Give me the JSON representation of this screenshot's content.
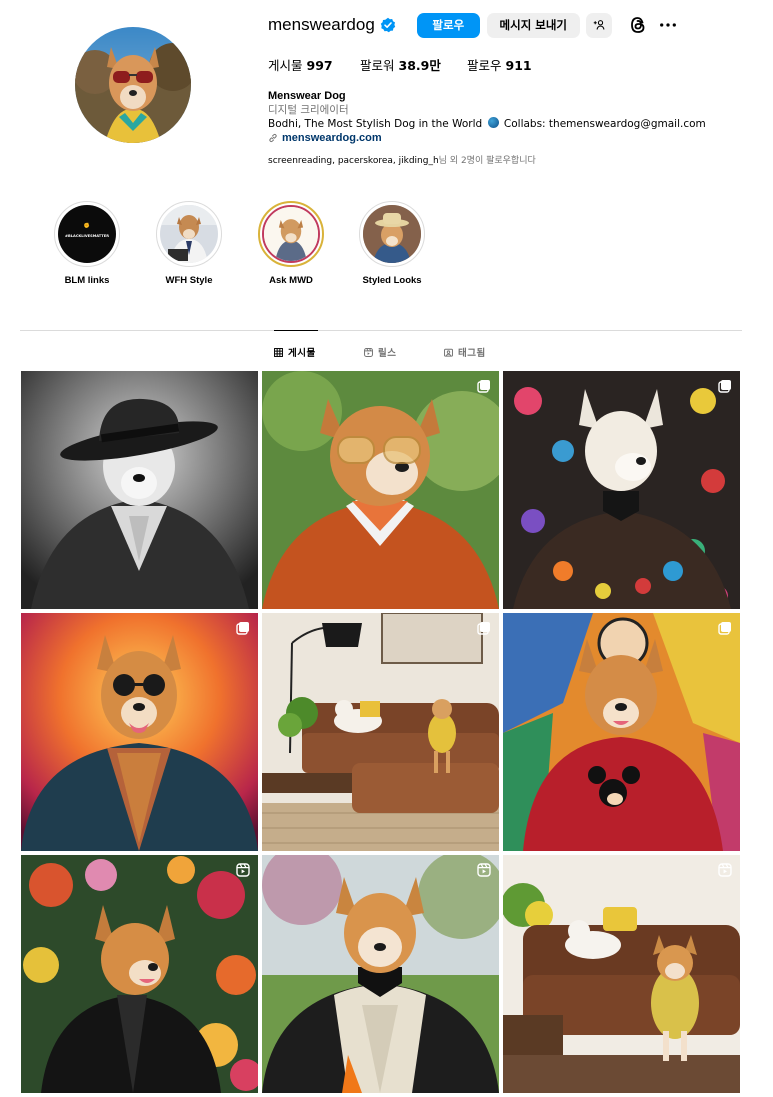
{
  "profile": {
    "username": "mensweardog",
    "follow_label": "팔로우",
    "message_label": "메시지 보내기",
    "suggest_label": "+°",
    "stats": {
      "posts_label": "게시물",
      "posts_value": "997",
      "followers_label": "팔로워",
      "followers_value": "38.9만",
      "following_label": "팔로우",
      "following_value": "911"
    },
    "full_name": "Menswear Dog",
    "category": "디지털 크리에이터",
    "bio_text_1": "Bodhi, The Most Stylish Dog in the World",
    "bio_text_2": "Collabs: themensweardog@gmail.com",
    "website": "mensweardog.com",
    "followed_by_names": "screenreading, pacerskorea, jikding_h",
    "followed_by_suffix": "님 외 2명이 팔로우합니다"
  },
  "highlights": [
    {
      "label": "BLM links",
      "cover_text": "#BLACKLIVESMATTER"
    },
    {
      "label": "WFH Style"
    },
    {
      "label": "Ask MWD"
    },
    {
      "label": "Styled Looks"
    }
  ],
  "tabs": [
    {
      "label": "게시물",
      "icon": "grid-icon",
      "active": true
    },
    {
      "label": "릴스",
      "icon": "reels-icon",
      "active": false
    },
    {
      "label": "태그됨",
      "icon": "tagged-icon",
      "active": false
    }
  ],
  "posts": [
    {
      "badge": "none"
    },
    {
      "badge": "carousel-icon"
    },
    {
      "badge": "carousel-icon"
    },
    {
      "badge": "carousel-icon"
    },
    {
      "badge": "carousel-icon"
    },
    {
      "badge": "carousel-icon"
    },
    {
      "badge": "reel-icon"
    },
    {
      "badge": "reel-icon"
    },
    {
      "badge": "reel-icon"
    }
  ],
  "colors": {
    "accent": "#0095f6",
    "link": "#00376b",
    "secondary_text": "#737373",
    "button_gray": "#efefef",
    "divider": "#dbdbdb"
  }
}
